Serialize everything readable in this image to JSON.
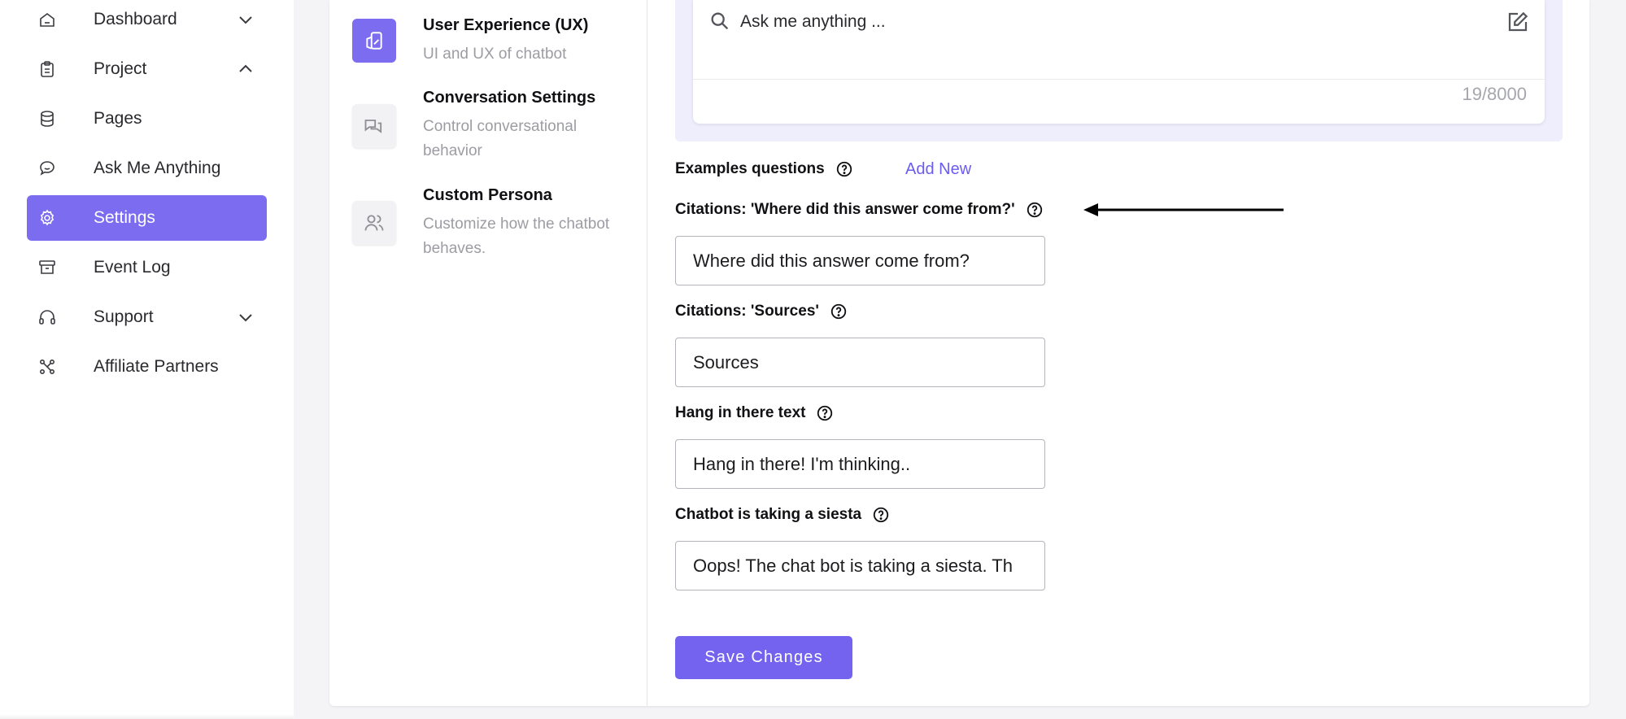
{
  "sidebar": {
    "items": [
      {
        "label": "Dashboard",
        "icon": "home-icon",
        "chevron": "chevron-down-icon"
      },
      {
        "label": "Project",
        "icon": "clipboard-icon",
        "chevron": "chevron-up-icon"
      },
      {
        "label": "Pages",
        "icon": "database-icon"
      },
      {
        "label": "Ask Me Anything",
        "icon": "chat-bubble-icon"
      },
      {
        "label": "Settings",
        "icon": "gear-icon",
        "active": true
      },
      {
        "label": "Event Log",
        "icon": "archive-icon"
      },
      {
        "label": "Support",
        "icon": "headset-icon",
        "chevron": "chevron-down-icon"
      },
      {
        "label": "Affiliate Partners",
        "icon": "network-icon"
      }
    ]
  },
  "settings_menu": {
    "items": [
      {
        "title": "User Experience (UX)",
        "description": "UI and UX of chatbot",
        "icon": "ux-icon",
        "active": true
      },
      {
        "title": "Conversation Settings",
        "description": "Control conversational behavior",
        "icon": "conversation-icon"
      },
      {
        "title": "Custom Persona",
        "description": "Customize how the chatbot behaves.",
        "icon": "users-icon"
      }
    ]
  },
  "preview": {
    "placeholder": "Ask me anything ...",
    "counter": "19/8000"
  },
  "form": {
    "examples_label": "Examples questions",
    "add_new": "Add New",
    "citations_question_label": "Citations: 'Where did this answer come from?'",
    "citations_question_value": "Where did this answer come from?",
    "citations_sources_label": "Citations: 'Sources'",
    "citations_sources_value": "Sources",
    "hang_in_label": "Hang in there text",
    "hang_in_value": "Hang in there! I'm thinking..",
    "siesta_label": "Chatbot is taking a siesta",
    "siesta_value": "Oops! The chat bot is taking a siesta. Th",
    "save_label": "Save Changes"
  },
  "colors": {
    "accent": "#7b6cf0",
    "preview_bg": "#efeefd",
    "link": "#6b5cf0"
  }
}
